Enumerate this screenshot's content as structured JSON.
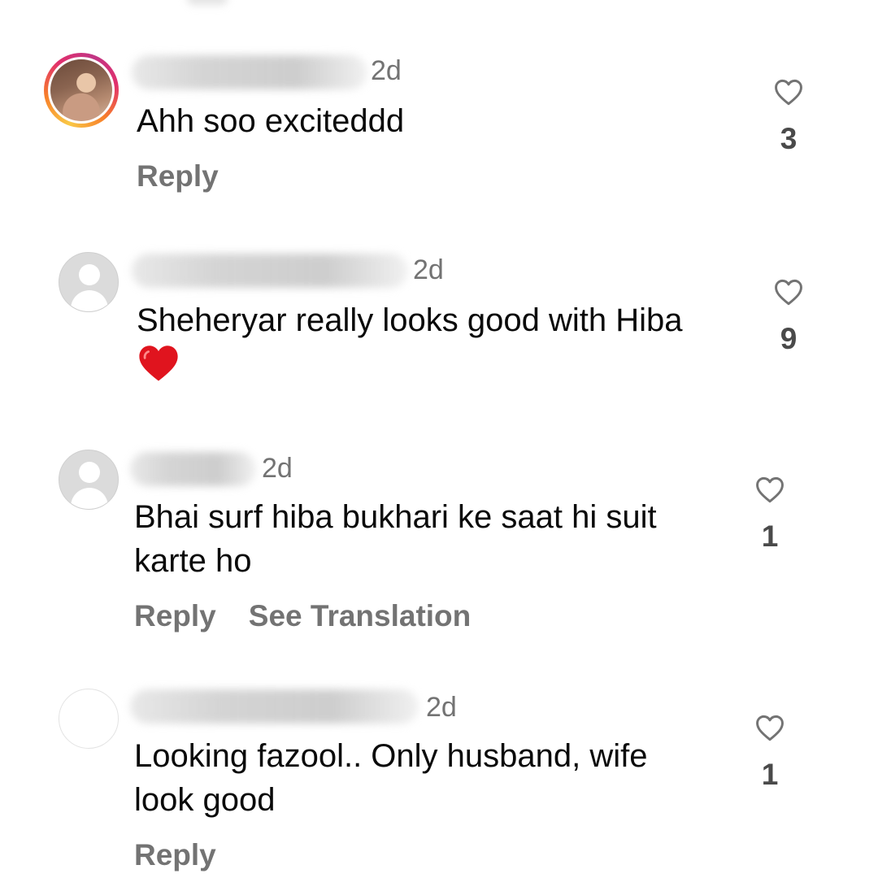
{
  "comments": [
    {
      "time": "2d",
      "text": "Ahh soo exciteddd",
      "likes": "3",
      "actions": {
        "reply": "Reply"
      }
    },
    {
      "time": "2d",
      "text": "Sheheryar really looks good with Hiba",
      "emoji": "red-heart",
      "likes": "9"
    },
    {
      "time": "2d",
      "text": "Bhai surf hiba bukhari ke saat hi suit karte ho",
      "likes": "1",
      "actions": {
        "reply": "Reply",
        "translate": "See Translation"
      }
    },
    {
      "time": "2d",
      "text": "Looking fazool.. Only husband, wife look good",
      "likes": "1",
      "actions": {
        "reply": "Reply"
      }
    }
  ],
  "colors": {
    "text": "#0a0a0a",
    "secondary": "#737373",
    "story_ring": "#e1306c",
    "emoji_heart": "#e0141e"
  },
  "icons": {
    "like": "heart-outline-icon",
    "emoji": "red-heart-icon"
  }
}
